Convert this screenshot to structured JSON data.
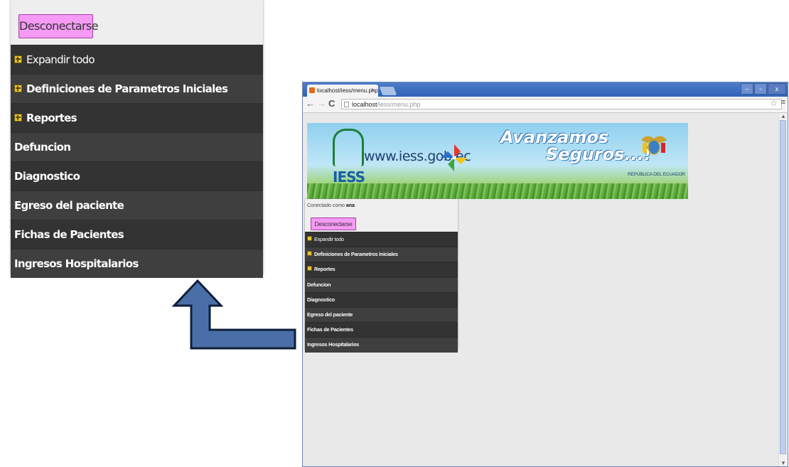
{
  "zoom_panel": {
    "logout_label": "Desconectarse",
    "menu": [
      {
        "label": "Expandir todo",
        "icon": "expand-icon",
        "bold": false
      },
      {
        "label": "Definiciones de Parametros Iniciales",
        "icon": "expand-icon",
        "bold": true
      },
      {
        "label": "Reportes",
        "icon": "expand-icon",
        "bold": true
      },
      {
        "label": "Defuncion",
        "icon": null,
        "bold": true
      },
      {
        "label": "Diagnostico",
        "icon": null,
        "bold": true
      },
      {
        "label": "Egreso del paciente",
        "icon": null,
        "bold": true
      },
      {
        "label": "Fichas de Pacientes",
        "icon": null,
        "bold": true
      },
      {
        "label": "Ingresos Hospitalarios",
        "icon": null,
        "bold": true
      }
    ]
  },
  "browser": {
    "tab_title": "localhost/iess/menu.php",
    "url_host": "localhost",
    "url_path": "/iess/menu.php",
    "banner": {
      "url_text": "www.iess.gob.ec",
      "logo_text": "IESS",
      "slogan_line1": "Avanzamos",
      "slogan_line2": "Seguros...!",
      "republica_text": "REPÚBLICA DEL ECUADOR"
    },
    "panel": {
      "connected_prefix": "Conectado como",
      "connected_user": "ana",
      "logout_label": "Desconectarse",
      "menu": [
        {
          "label": "Expandir todo",
          "icon": "expand-icon",
          "bold": false
        },
        {
          "label": "Definiciones de Parametros Iniciales",
          "icon": "expand-icon",
          "bold": true
        },
        {
          "label": "Reportes",
          "icon": "expand-icon",
          "bold": true
        },
        {
          "label": "Defuncion",
          "icon": null,
          "bold": true
        },
        {
          "label": "Diagnostico",
          "icon": null,
          "bold": true
        },
        {
          "label": "Egreso del paciente",
          "icon": null,
          "bold": true
        },
        {
          "label": "Fichas de Pacientes",
          "icon": null,
          "bold": true
        },
        {
          "label": "Ingresos Hospitalarios",
          "icon": null,
          "bold": true
        }
      ]
    }
  },
  "colors": {
    "logout_button": "#f59af5",
    "menu_bg": "#3b3b3b",
    "arrow": "#4a6fa8",
    "titlebar": "#3a6fc0"
  }
}
